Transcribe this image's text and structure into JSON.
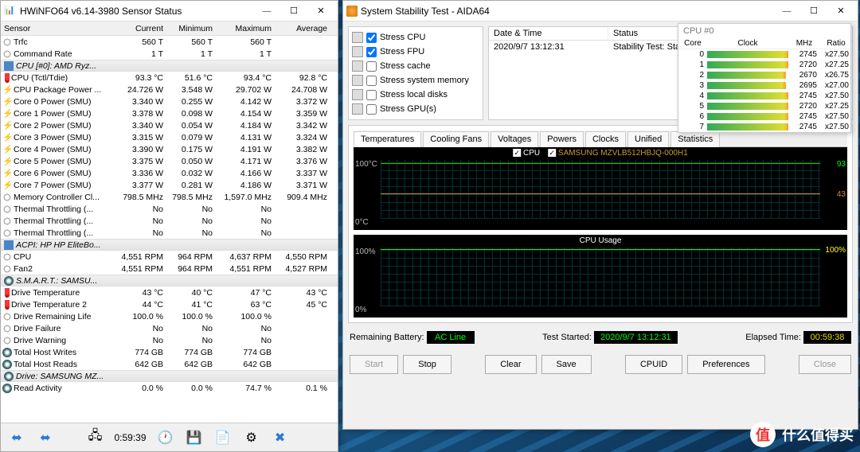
{
  "hwinfo": {
    "title": "HWiNFO64 v6.14-3980 Sensor Status",
    "columns": [
      "Sensor",
      "Current",
      "Minimum",
      "Maximum",
      "Average"
    ],
    "groups": [
      {
        "name": "",
        "rows": [
          {
            "ico": "clock",
            "label": "Trfc",
            "c": "560 T",
            "mi": "560 T",
            "ma": "560 T",
            "a": ""
          },
          {
            "ico": "clock",
            "label": "Command Rate",
            "c": "1 T",
            "mi": "1 T",
            "ma": "1 T",
            "a": ""
          }
        ]
      },
      {
        "name": "CPU [#0]: AMD Ryz...",
        "gico": "chip",
        "rows": [
          {
            "ico": "temp",
            "label": "CPU (Tctl/Tdie)",
            "c": "93.3 °C",
            "mi": "51.6 °C",
            "ma": "93.4 °C",
            "a": "92.8 °C"
          },
          {
            "ico": "bolt",
            "label": "CPU Package Power ...",
            "c": "24.726 W",
            "mi": "3.548 W",
            "ma": "29.702 W",
            "a": "24.708 W"
          },
          {
            "ico": "bolt",
            "label": "Core 0 Power (SMU)",
            "c": "3.340 W",
            "mi": "0.255 W",
            "ma": "4.142 W",
            "a": "3.372 W"
          },
          {
            "ico": "bolt",
            "label": "Core 1 Power (SMU)",
            "c": "3.378 W",
            "mi": "0.098 W",
            "ma": "4.154 W",
            "a": "3.359 W"
          },
          {
            "ico": "bolt",
            "label": "Core 2 Power (SMU)",
            "c": "3.340 W",
            "mi": "0.054 W",
            "ma": "4.184 W",
            "a": "3.342 W"
          },
          {
            "ico": "bolt",
            "label": "Core 3 Power (SMU)",
            "c": "3.315 W",
            "mi": "0.079 W",
            "ma": "4.131 W",
            "a": "3.324 W"
          },
          {
            "ico": "bolt",
            "label": "Core 4 Power (SMU)",
            "c": "3.390 W",
            "mi": "0.175 W",
            "ma": "4.191 W",
            "a": "3.382 W"
          },
          {
            "ico": "bolt",
            "label": "Core 5 Power (SMU)",
            "c": "3.375 W",
            "mi": "0.050 W",
            "ma": "4.171 W",
            "a": "3.376 W"
          },
          {
            "ico": "bolt",
            "label": "Core 6 Power (SMU)",
            "c": "3.336 W",
            "mi": "0.032 W",
            "ma": "4.166 W",
            "a": "3.337 W"
          },
          {
            "ico": "bolt",
            "label": "Core 7 Power (SMU)",
            "c": "3.377 W",
            "mi": "0.281 W",
            "ma": "4.186 W",
            "a": "3.371 W"
          },
          {
            "ico": "clock",
            "label": "Memory Controller Cl...",
            "c": "798.5 MHz",
            "mi": "798.5 MHz",
            "ma": "1,597.0 MHz",
            "a": "909.4 MHz"
          },
          {
            "ico": "clock",
            "label": "Thermal Throttling (...",
            "c": "No",
            "mi": "No",
            "ma": "No",
            "a": ""
          },
          {
            "ico": "clock",
            "label": "Thermal Throttling (...",
            "c": "No",
            "mi": "No",
            "ma": "No",
            "a": ""
          },
          {
            "ico": "clock",
            "label": "Thermal Throttling (...",
            "c": "No",
            "mi": "No",
            "ma": "No",
            "a": ""
          }
        ]
      },
      {
        "name": "ACPI: HP HP EliteBo...",
        "gico": "chip",
        "rows": [
          {
            "ico": "clock",
            "label": "CPU",
            "c": "4,551 RPM",
            "mi": "964 RPM",
            "ma": "4,637 RPM",
            "a": "4,550 RPM"
          },
          {
            "ico": "clock",
            "label": "Fan2",
            "c": "4,551 RPM",
            "mi": "964 RPM",
            "ma": "4,551 RPM",
            "a": "4,527 RPM"
          }
        ]
      },
      {
        "name": "S.M.A.R.T.: SAMSU...",
        "gico": "disk",
        "rows": [
          {
            "ico": "temp",
            "label": "Drive Temperature",
            "c": "43 °C",
            "mi": "40 °C",
            "ma": "47 °C",
            "a": "43 °C"
          },
          {
            "ico": "temp",
            "label": "Drive Temperature 2",
            "c": "44 °C",
            "mi": "41 °C",
            "ma": "63 °C",
            "a": "45 °C"
          },
          {
            "ico": "clock",
            "label": "Drive Remaining Life",
            "c": "100.0 %",
            "mi": "100.0 %",
            "ma": "100.0 %",
            "a": ""
          },
          {
            "ico": "clock",
            "label": "Drive Failure",
            "c": "No",
            "mi": "No",
            "ma": "No",
            "a": ""
          },
          {
            "ico": "clock",
            "label": "Drive Warning",
            "c": "No",
            "mi": "No",
            "ma": "No",
            "a": ""
          },
          {
            "ico": "disk",
            "label": "Total Host Writes",
            "c": "774 GB",
            "mi": "774 GB",
            "ma": "774 GB",
            "a": ""
          },
          {
            "ico": "disk",
            "label": "Total Host Reads",
            "c": "642 GB",
            "mi": "642 GB",
            "ma": "642 GB",
            "a": ""
          }
        ]
      },
      {
        "name": "Drive: SAMSUNG MZ...",
        "gico": "disk",
        "rows": [
          {
            "ico": "disk",
            "label": "Read Activity",
            "c": "0.0 %",
            "mi": "0.0 %",
            "ma": "74.7 %",
            "a": "0.1 %"
          }
        ]
      }
    ],
    "timer": "0:59:39"
  },
  "aida": {
    "title": "System Stability Test - AIDA64",
    "stress": [
      {
        "label": "Stress CPU",
        "checked": true
      },
      {
        "label": "Stress FPU",
        "checked": true
      },
      {
        "label": "Stress cache",
        "checked": false
      },
      {
        "label": "Stress system memory",
        "checked": false
      },
      {
        "label": "Stress local disks",
        "checked": false
      },
      {
        "label": "Stress GPU(s)",
        "checked": false
      }
    ],
    "status_hdr": [
      "Date & Time",
      "Status"
    ],
    "status_row": [
      "2020/9/7 13:12:31",
      "Stability Test: Started"
    ],
    "cpu_overlay": {
      "title": "CPU #0",
      "cols": [
        "Core",
        "Clock",
        "MHz",
        "Ratio"
      ],
      "rows": [
        {
          "n": "0",
          "mhz": "2745",
          "r": "x27.50",
          "full": true
        },
        {
          "n": "1",
          "mhz": "2720",
          "r": "x27.25",
          "full": true
        },
        {
          "n": "2",
          "mhz": "2670",
          "r": "x26.75",
          "full": false
        },
        {
          "n": "3",
          "mhz": "2695",
          "r": "x27.00",
          "full": false
        },
        {
          "n": "4",
          "mhz": "2745",
          "r": "x27.50",
          "full": true
        },
        {
          "n": "5",
          "mhz": "2720",
          "r": "x27.25",
          "full": true
        },
        {
          "n": "6",
          "mhz": "2745",
          "r": "x27.50",
          "full": true
        },
        {
          "n": "7",
          "mhz": "2745",
          "r": "x27.50",
          "full": true
        }
      ]
    },
    "tabs": [
      "Temperatures",
      "Cooling Fans",
      "Voltages",
      "Powers",
      "Clocks",
      "Unified",
      "Statistics"
    ],
    "chart_data": [
      {
        "type": "line",
        "title": "",
        "legend": [
          "CPU",
          "SAMSUNG MZVLB512HBJQ-000H1"
        ],
        "ylabel": "°C",
        "ylim": [
          0,
          100
        ],
        "y_right_labels": [
          93,
          43
        ],
        "series": [
          {
            "name": "CPU",
            "approx_value": 93,
            "color": "#00cc00"
          },
          {
            "name": "SAMSUNG MZVLB512HBJQ-000H1",
            "approx_value": 43,
            "color": "#cc8844"
          }
        ]
      },
      {
        "type": "line",
        "title": "CPU Usage",
        "ylabel": "%",
        "ylim": [
          0,
          100
        ],
        "y_right_labels": [
          100
        ],
        "series": [
          {
            "name": "CPU Usage",
            "approx_value": 100,
            "color": "#00ff00"
          }
        ]
      }
    ],
    "temp_labels": {
      "top": "100°C",
      "bot": "0°C",
      "r1": "93",
      "r2": "43"
    },
    "usage_labels": {
      "top": "100%",
      "bot": "0%",
      "r1": "100%",
      "title": "CPU Usage"
    },
    "info": {
      "battery_label": "Remaining Battery:",
      "battery_val": "AC Line",
      "started_label": "Test Started:",
      "started_val": "2020/9/7 13:12:31",
      "elapsed_label": "Elapsed Time:",
      "elapsed_val": "00:59:38"
    },
    "buttons": {
      "start": "Start",
      "stop": "Stop",
      "clear": "Clear",
      "save": "Save",
      "cpuid": "CPUID",
      "prefs": "Preferences",
      "close": "Close"
    }
  },
  "watermark": "什么值得买"
}
